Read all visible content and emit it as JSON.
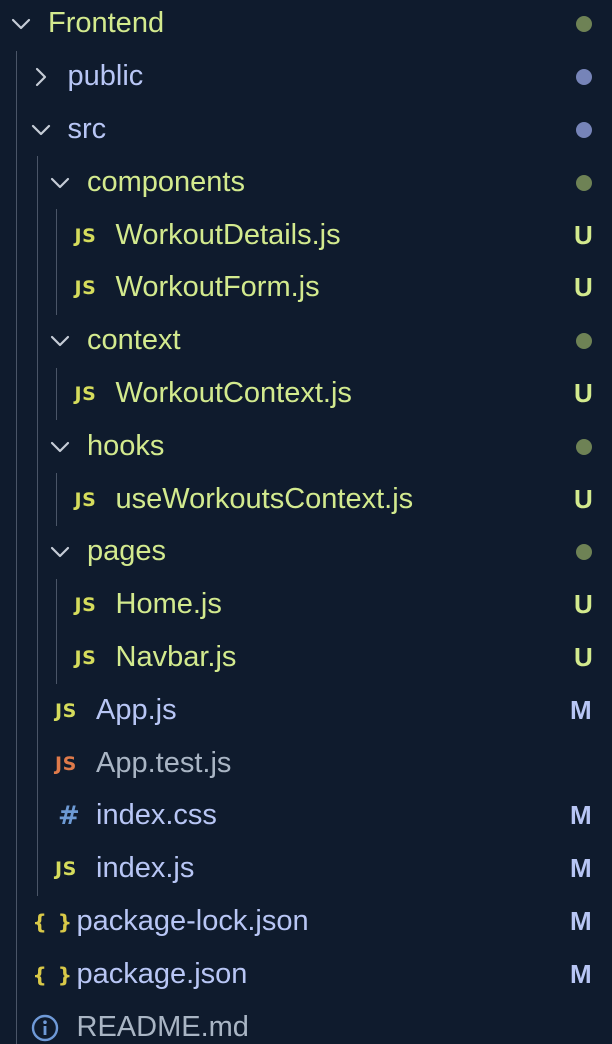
{
  "colors": {
    "background": "#0f1b2d",
    "untracked": "#d3ea8e",
    "modified": "#b8c6f5",
    "default": "#a9b5c4",
    "guide": "#4a5567",
    "dot_untracked": "#6e8255",
    "dot_modified": "#7684b8",
    "js_icon": "#d5dc5c",
    "js_test_icon": "#df7a4a",
    "css_icon": "#6d9ad4",
    "json_icon": "#d9c948",
    "info_icon": "#6f9ad8"
  },
  "rows": [
    {
      "name": "folder-frontend",
      "label": "Frontend",
      "level": 0,
      "kind": "folder",
      "open": true,
      "status": "untracked",
      "badge": ""
    },
    {
      "name": "folder-public",
      "label": "public",
      "level": 1,
      "kind": "folder",
      "open": false,
      "status": "modified",
      "badge": ""
    },
    {
      "name": "folder-src",
      "label": "src",
      "level": 1,
      "kind": "folder",
      "open": true,
      "status": "modified",
      "badge": ""
    },
    {
      "name": "folder-components",
      "label": "components",
      "level": 2,
      "kind": "folder",
      "open": true,
      "status": "untracked",
      "badge": ""
    },
    {
      "name": "file-workoutdetails-js",
      "label": "WorkoutDetails.js",
      "level": 3,
      "kind": "js",
      "status": "untracked",
      "badge": "U"
    },
    {
      "name": "file-workoutform-js",
      "label": "WorkoutForm.js",
      "level": 3,
      "kind": "js",
      "status": "untracked",
      "badge": "U"
    },
    {
      "name": "folder-context",
      "label": "context",
      "level": 2,
      "kind": "folder",
      "open": true,
      "status": "untracked",
      "badge": ""
    },
    {
      "name": "file-workoutcontext-js",
      "label": "WorkoutContext.js",
      "level": 3,
      "kind": "js",
      "status": "untracked",
      "badge": "U"
    },
    {
      "name": "folder-hooks",
      "label": "hooks",
      "level": 2,
      "kind": "folder",
      "open": true,
      "status": "untracked",
      "badge": ""
    },
    {
      "name": "file-useworkoutscontext-js",
      "label": "useWorkoutsContext.js",
      "level": 3,
      "kind": "js",
      "status": "untracked",
      "badge": "U"
    },
    {
      "name": "folder-pages",
      "label": "pages",
      "level": 2,
      "kind": "folder",
      "open": true,
      "status": "untracked",
      "badge": ""
    },
    {
      "name": "file-home-js",
      "label": "Home.js",
      "level": 3,
      "kind": "js",
      "status": "untracked",
      "badge": "U"
    },
    {
      "name": "file-navbar-js",
      "label": "Navbar.js",
      "level": 3,
      "kind": "js",
      "status": "untracked",
      "badge": "U"
    },
    {
      "name": "file-app-js",
      "label": "App.js",
      "level": 2,
      "kind": "js",
      "status": "modified",
      "badge": "M"
    },
    {
      "name": "file-app-test-js",
      "label": "App.test.js",
      "level": 2,
      "kind": "js-test",
      "status": "default",
      "badge": ""
    },
    {
      "name": "file-index-css",
      "label": "index.css",
      "level": 2,
      "kind": "css",
      "status": "modified",
      "badge": "M"
    },
    {
      "name": "file-index-js",
      "label": "index.js",
      "level": 2,
      "kind": "js",
      "status": "modified",
      "badge": "M"
    },
    {
      "name": "file-package-lock-json",
      "label": "package-lock.json",
      "level": 1,
      "kind": "json",
      "status": "modified",
      "badge": "M"
    },
    {
      "name": "file-package-json",
      "label": "package.json",
      "level": 1,
      "kind": "json",
      "status": "modified",
      "badge": "M"
    },
    {
      "name": "file-readme-md",
      "label": "README.md",
      "level": 1,
      "kind": "info",
      "status": "default",
      "badge": ""
    }
  ],
  "icon_text": {
    "js": "JS",
    "json": "{ }",
    "css": "#"
  }
}
